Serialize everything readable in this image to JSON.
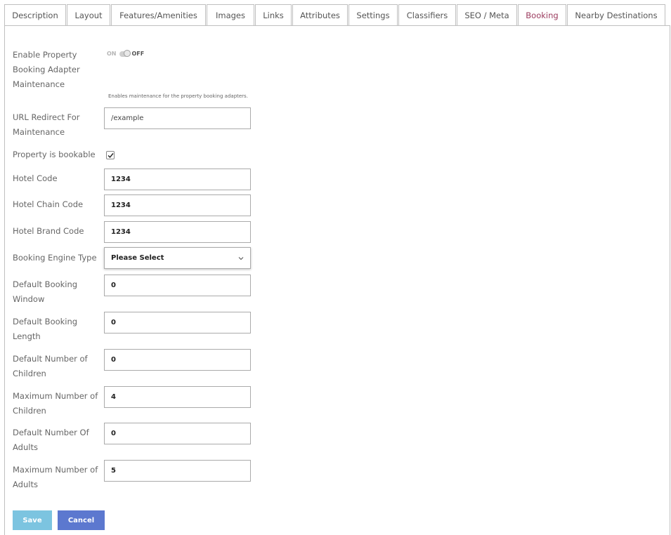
{
  "tabs": [
    {
      "label": "Description"
    },
    {
      "label": "Layout"
    },
    {
      "label": "Features/Amenities"
    },
    {
      "label": "Images"
    },
    {
      "label": "Links"
    },
    {
      "label": "Attributes"
    },
    {
      "label": "Settings"
    },
    {
      "label": "Classifiers"
    },
    {
      "label": "SEO / Meta"
    },
    {
      "label": "Booking"
    },
    {
      "label": "Nearby Destinations"
    }
  ],
  "active_tab": "Booking",
  "colors": {
    "active_tab": "#9b3b5e",
    "save_button": "#7cc4e0",
    "cancel_button": "#5c78cf"
  },
  "form": {
    "maintenance": {
      "label_line1": "Enable Property",
      "label_line2": "Booking Adapter",
      "label_line3": "Maintenance",
      "toggle_on": "ON",
      "toggle_off": "OFF",
      "hint": "Enables maintenance for the property booking adapters."
    },
    "url_redirect": {
      "label_line1": "URL Redirect For",
      "label_line2": "Maintenance",
      "value": "/example"
    },
    "bookable": {
      "label": "Property is bookable",
      "checked": true
    },
    "hotel_code": {
      "label": "Hotel Code",
      "value": "1234"
    },
    "hotel_chain_code": {
      "label": "Hotel Chain Code",
      "value": "1234"
    },
    "hotel_brand_code": {
      "label": "Hotel Brand Code",
      "value": "1234"
    },
    "booking_engine_type": {
      "label": "Booking Engine Type",
      "selected": "Please Select"
    },
    "default_booking_window": {
      "label_line1": "Default Booking",
      "label_line2": "Window",
      "value": "0"
    },
    "default_booking_length": {
      "label_line1": "Default Booking",
      "label_line2": "Length",
      "value": "0"
    },
    "default_children": {
      "label_line1": "Default Number of",
      "label_line2": "Children",
      "value": "0"
    },
    "max_children": {
      "label_line1": "Maximum Number of",
      "label_line2": "Children",
      "value": "4"
    },
    "default_adults": {
      "label_line1": "Default Number Of",
      "label_line2": "Adults",
      "value": "0"
    },
    "max_adults": {
      "label_line1": "Maximum Number of",
      "label_line2": "Adults",
      "value": "5"
    }
  },
  "buttons": {
    "save": "Save",
    "cancel": "Cancel"
  }
}
